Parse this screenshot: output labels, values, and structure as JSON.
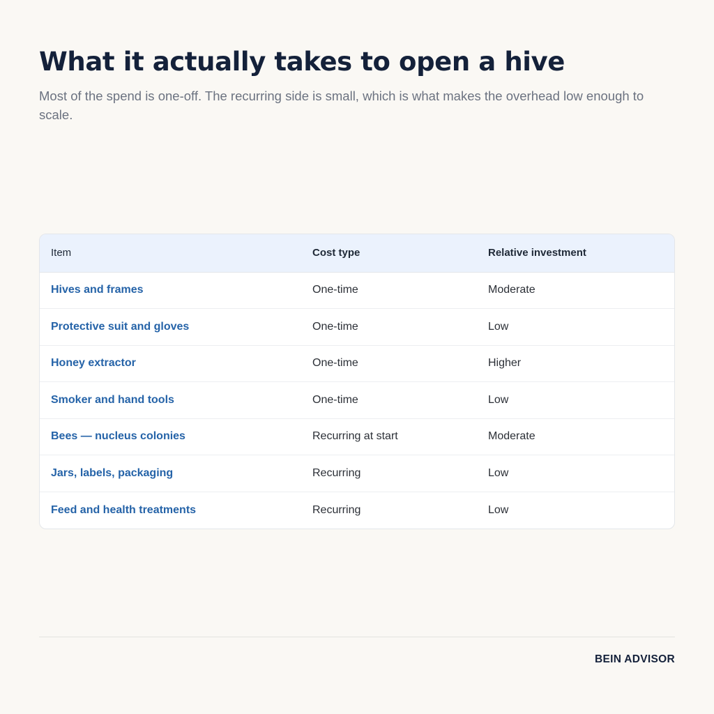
{
  "header": {
    "title": "What it actually takes to open a hive",
    "subtitle": "Most of the spend is one-off. The recurring side is small, which is what makes the overhead low enough to scale."
  },
  "table": {
    "columns": [
      "Item",
      "Cost type",
      "Relative investment"
    ],
    "rows": [
      {
        "item": "Hives and frames",
        "cost_type": "One-time",
        "investment": "Moderate"
      },
      {
        "item": "Protective suit and gloves",
        "cost_type": "One-time",
        "investment": "Low"
      },
      {
        "item": "Honey extractor",
        "cost_type": "One-time",
        "investment": "Higher"
      },
      {
        "item": "Smoker and hand tools",
        "cost_type": "One-time",
        "investment": "Low"
      },
      {
        "item": "Bees — nucleus colonies",
        "cost_type": "Recurring at start",
        "investment": "Moderate"
      },
      {
        "item": "Jars, labels, packaging",
        "cost_type": "Recurring",
        "investment": "Low"
      },
      {
        "item": "Feed and health treatments",
        "cost_type": "Recurring",
        "investment": "Low"
      }
    ]
  },
  "footer": {
    "brand": "BEIN ADVISOR"
  },
  "colors": {
    "background": "#faf8f4",
    "title": "#14213a",
    "item_link": "#2563a8",
    "header_row": "#ebf2fd"
  }
}
